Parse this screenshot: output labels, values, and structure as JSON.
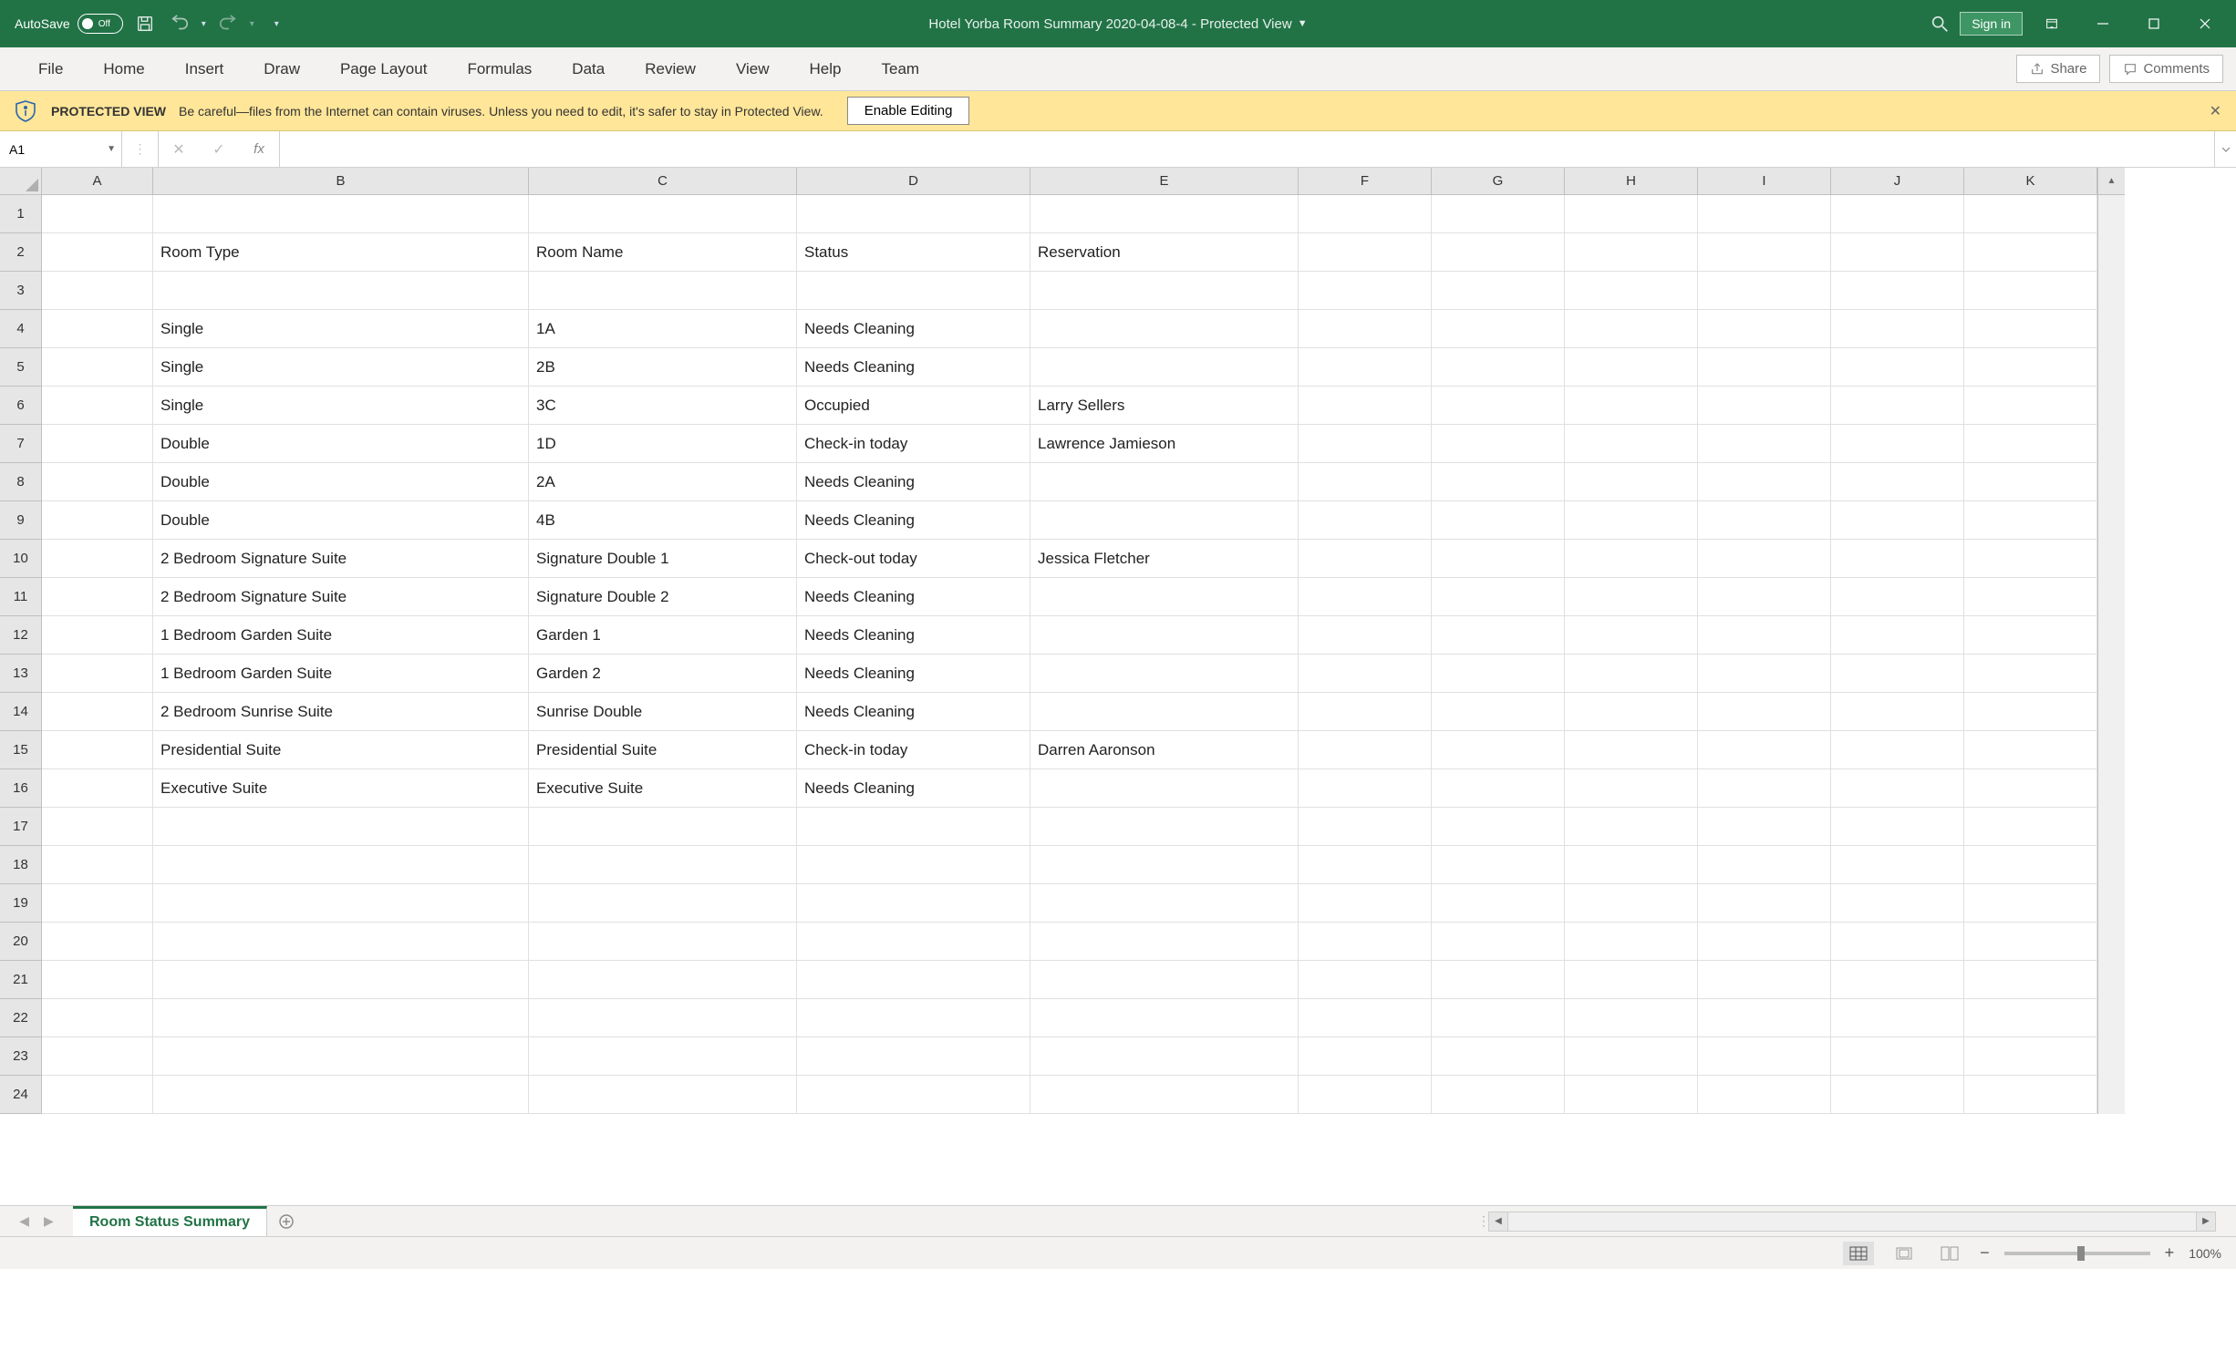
{
  "titlebar": {
    "autosave_label": "AutoSave",
    "autosave_state": "Off",
    "doc_title": "Hotel Yorba Room Summary 2020-04-08-4  -  Protected View",
    "signin": "Sign in"
  },
  "ribbon": {
    "tabs": [
      "File",
      "Home",
      "Insert",
      "Draw",
      "Page Layout",
      "Formulas",
      "Data",
      "Review",
      "View",
      "Help",
      "Team"
    ],
    "share": "Share",
    "comments": "Comments"
  },
  "protected": {
    "title": "PROTECTED VIEW",
    "msg": "Be careful—files from the Internet can contain viruses. Unless you need to edit, it's safer to stay in Protected View.",
    "enable": "Enable Editing"
  },
  "fx": {
    "name": "A1",
    "formula": ""
  },
  "columns": [
    "A",
    "B",
    "C",
    "D",
    "E",
    "F",
    "G",
    "H",
    "I",
    "J",
    "K"
  ],
  "rows_count": 24,
  "headers": {
    "B": "Room Type",
    "C": "Room Name",
    "D": "Status",
    "E": "Reservation"
  },
  "data": [
    {
      "B": "Single",
      "C": "1A",
      "D": "Needs Cleaning",
      "E": ""
    },
    {
      "B": "Single",
      "C": "2B",
      "D": "Needs Cleaning",
      "E": ""
    },
    {
      "B": "Single",
      "C": "3C",
      "D": "Occupied",
      "E": "Larry Sellers"
    },
    {
      "B": "Double",
      "C": "1D",
      "D": "Check-in today",
      "E": "Lawrence Jamieson"
    },
    {
      "B": "Double",
      "C": "2A",
      "D": "Needs Cleaning",
      "E": ""
    },
    {
      "B": "Double",
      "C": "4B",
      "D": "Needs Cleaning",
      "E": ""
    },
    {
      "B": "2 Bedroom Signature Suite",
      "C": "Signature Double 1",
      "D": "Check-out today",
      "E": "Jessica Fletcher"
    },
    {
      "B": "2 Bedroom Signature Suite",
      "C": "Signature Double 2",
      "D": "Needs Cleaning",
      "E": ""
    },
    {
      "B": "1 Bedroom Garden Suite",
      "C": "Garden 1",
      "D": "Needs Cleaning",
      "E": ""
    },
    {
      "B": "1 Bedroom Garden Suite",
      "C": "Garden 2",
      "D": "Needs Cleaning",
      "E": ""
    },
    {
      "B": "2 Bedroom Sunrise Suite",
      "C": "Sunrise Double",
      "D": "Needs Cleaning",
      "E": ""
    },
    {
      "B": "Presidential Suite",
      "C": "Presidential Suite",
      "D": "Check-in today",
      "E": "Darren Aaronson"
    },
    {
      "B": "Executive Suite",
      "C": "Executive Suite",
      "D": "Needs Cleaning",
      "E": ""
    }
  ],
  "sheet": {
    "active": "Room Status Summary"
  },
  "status": {
    "zoom": "100%"
  }
}
